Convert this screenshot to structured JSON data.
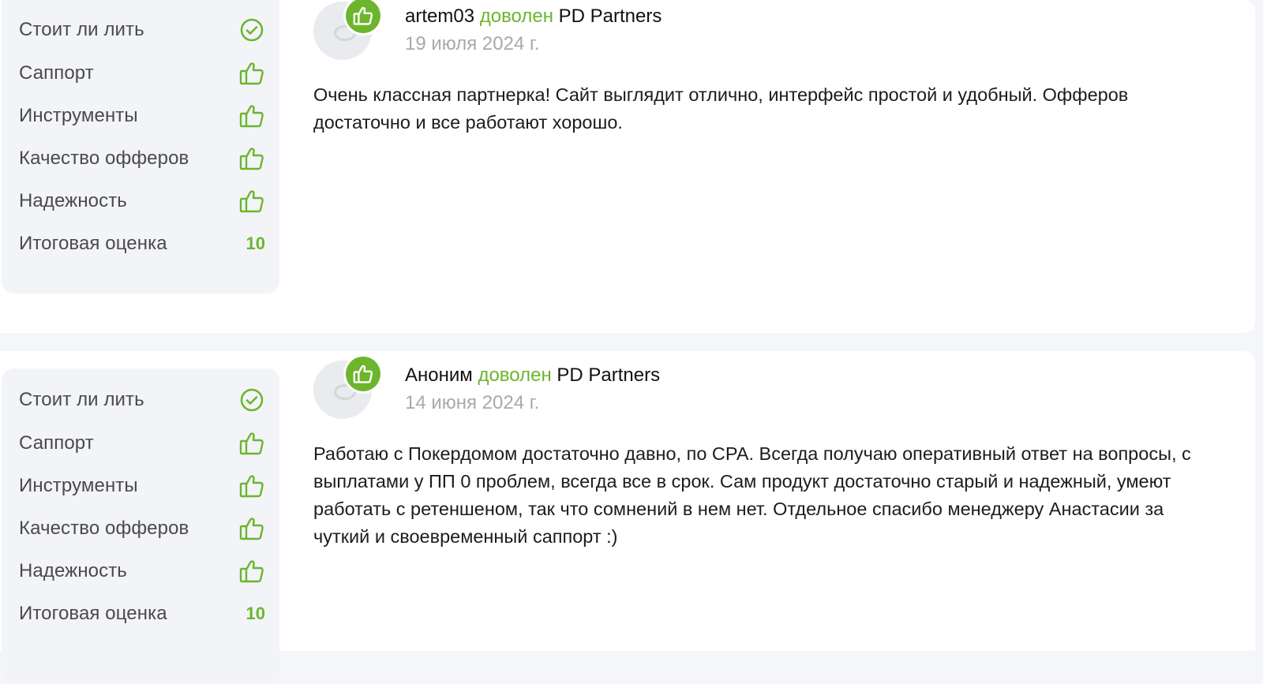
{
  "colors": {
    "accent": "#6cb52d",
    "text": "#1c1c1c",
    "muted": "#a9a9a9",
    "panel": "#f3f4f8"
  },
  "reviews": [
    {
      "ratings": [
        {
          "label": "Стоит ли лить",
          "icon": "check-circle-icon"
        },
        {
          "label": "Саппорт",
          "icon": "thumbs-up-icon"
        },
        {
          "label": "Инструменты",
          "icon": "thumbs-up-icon"
        },
        {
          "label": "Качество офферов",
          "icon": "thumbs-up-icon"
        },
        {
          "label": "Надежность",
          "icon": "thumbs-up-icon"
        }
      ],
      "total_label": "Итоговая оценка",
      "total_score": "10",
      "author": "artem03",
      "verdict": "доволен",
      "program": "PD Partners",
      "date": "19 июля 2024 г.",
      "text": "Очень классная партнерка! Сайт выглядит отлично, интерфейс простой и удобный. Офферов достаточно и все работают хорошо."
    },
    {
      "ratings": [
        {
          "label": "Стоит ли лить",
          "icon": "check-circle-icon"
        },
        {
          "label": "Саппорт",
          "icon": "thumbs-up-icon"
        },
        {
          "label": "Инструменты",
          "icon": "thumbs-up-icon"
        },
        {
          "label": "Качество офферов",
          "icon": "thumbs-up-icon"
        },
        {
          "label": "Надежность",
          "icon": "thumbs-up-icon"
        }
      ],
      "total_label": "Итоговая оценка",
      "total_score": "10",
      "author": "Аноним",
      "verdict": "доволен",
      "program": "PD Partners",
      "date": "14 июня 2024 г.",
      "text": "Работаю с Покердомом достаточно давно, по CPA. Всегда получаю оперативный ответ на вопросы, с выплатами у ПП 0 проблем, всегда все в срок. Сам продукт достаточно старый и надежный, умеют работать с ретеншеном, так что сомнений в нем нет. Отдельное спасибо менеджеру Анастасии за чуткий и своевременный саппорт :)"
    }
  ]
}
